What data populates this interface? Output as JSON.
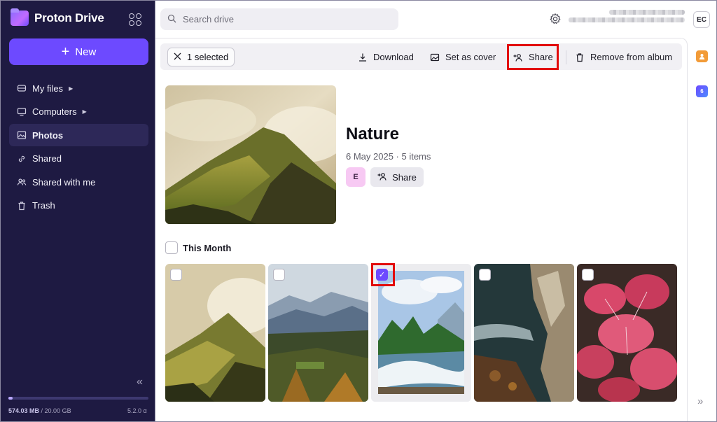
{
  "app": {
    "brand": "Proton Drive",
    "new_label": "New",
    "search_placeholder": "Search drive",
    "user_initials": "EC"
  },
  "sidebar": {
    "items": [
      {
        "label": "My files",
        "icon": "hdd-icon",
        "expandable": true
      },
      {
        "label": "Computers",
        "icon": "monitor-icon",
        "expandable": true
      },
      {
        "label": "Photos",
        "icon": "image-icon",
        "active": true
      },
      {
        "label": "Shared",
        "icon": "link-icon"
      },
      {
        "label": "Shared with me",
        "icon": "users-icon"
      },
      {
        "label": "Trash",
        "icon": "trash-icon"
      }
    ],
    "storage_used": "574.03 MB",
    "storage_total": "20.00 GB",
    "storage_sep": " / ",
    "storage_fraction": 0.028,
    "version": "5.2.0 α"
  },
  "toolbar": {
    "selected_label": "1 selected",
    "download_label": "Download",
    "set_cover_label": "Set as cover",
    "share_label": "Share",
    "remove_label": "Remove from album"
  },
  "album": {
    "title": "Nature",
    "meta": "6 May 2025 · 5 items",
    "member_initial": "E",
    "share_label": "Share"
  },
  "section": {
    "title": "This Month"
  },
  "photos": [
    {
      "name": "misty-mountain",
      "selected": false
    },
    {
      "name": "alpine-valley",
      "selected": false
    },
    {
      "name": "river-rapids",
      "selected": true
    },
    {
      "name": "rocky-stream",
      "selected": false
    },
    {
      "name": "red-leaves",
      "selected": false
    }
  ],
  "rail": {
    "badge": "6"
  },
  "colors": {
    "sidebar_bg": "#1e1a42",
    "accent": "#6d4aff",
    "highlight": "#e20b0b"
  }
}
